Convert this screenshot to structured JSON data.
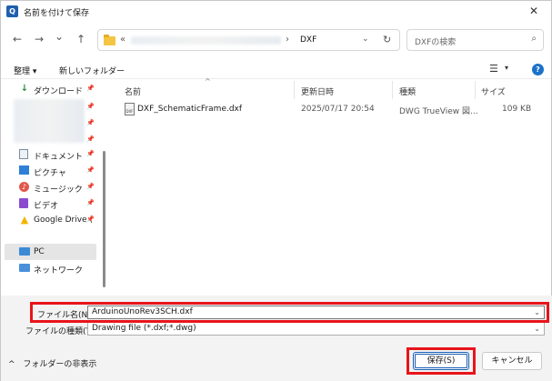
{
  "window": {
    "title": "名前を付けて保存",
    "close_glyph": "✕"
  },
  "nav": {
    "back_glyph": "←",
    "forward_glyph": "→",
    "recent_glyph": "⌄",
    "up_glyph": "↑"
  },
  "address": {
    "overflow": "«",
    "separator": "›",
    "current": "DXF",
    "dropdown_glyph": "⌄",
    "refresh_glyph": "↻"
  },
  "search": {
    "placeholder": "DXFの検索",
    "icon_glyph": "⌕"
  },
  "toolbar": {
    "organize": "整理 ▾",
    "new_folder": "新しいフォルダー",
    "view_glyph": "☰",
    "view_dd_glyph": "▾",
    "help_glyph": "?"
  },
  "sidebar": {
    "downloads": "ダウンロード",
    "documents": "ドキュメント",
    "pictures": "ピクチャ",
    "music": "ミュージック",
    "videos": "ビデオ",
    "google_drive": "Google Drive (",
    "pc": "PC",
    "network": "ネットワーク",
    "pin_glyph": "📌"
  },
  "columns": {
    "name": "名前",
    "modified": "更新日時",
    "type": "種類",
    "size": "サイズ",
    "sort_glyph": "^"
  },
  "files": [
    {
      "name": "DXF_SchematicFrame.dxf",
      "modified": "2025/07/17 20:54",
      "type": "DWG TrueView 図...",
      "size": "109 KB",
      "icon_text": "DXF"
    }
  ],
  "form": {
    "filename_label": "ファイル名(N):",
    "filename_value": "ArduinoUnoRev3SCH.dxf",
    "filetype_label": "ファイルの種類(T):",
    "filetype_value": "Drawing file (*.dxf;*.dwg)",
    "dd_glyph": "⌄"
  },
  "footer": {
    "hide_folders": "フォルダーの非表示",
    "hide_glyph": "^",
    "save": "保存(S)",
    "cancel": "キャンセル"
  },
  "colors": {
    "highlight": "#e8141b",
    "accent": "#1a5fb4"
  }
}
